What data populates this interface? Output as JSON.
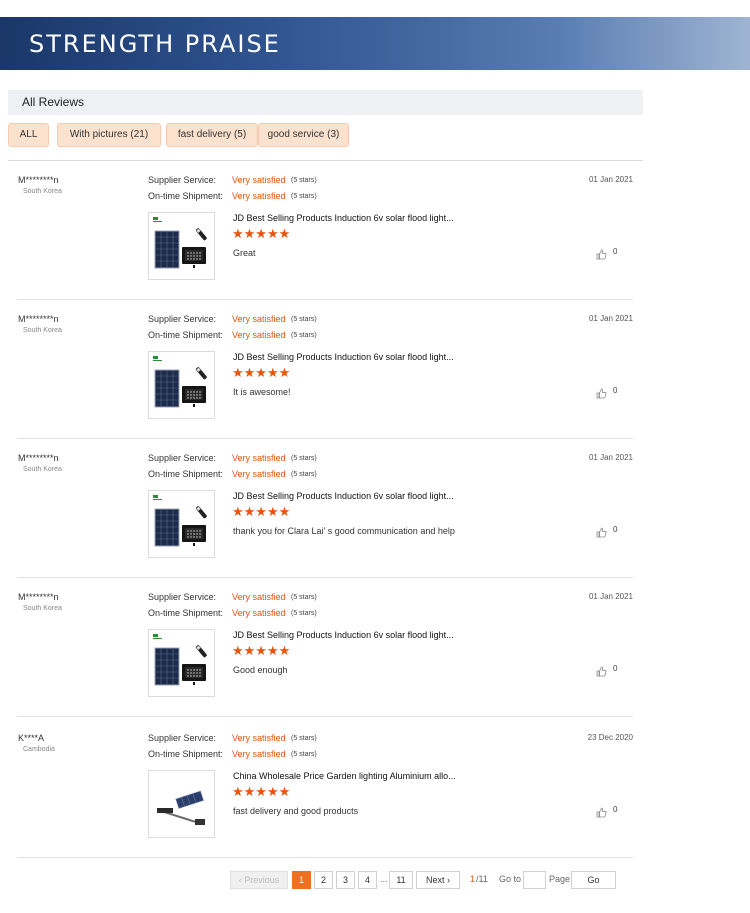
{
  "banner": {
    "title": "STRENGTH PRAISE"
  },
  "tabs": {
    "all_reviews": "All Reviews"
  },
  "filters": [
    "ALL",
    "With pictures (21)",
    "fast delivery (5)",
    "good service (3)"
  ],
  "labels": {
    "supplier_service": "Supplier Service:",
    "ontime_shipment": "On-time Shipment:",
    "very_satisfied": "Very satisfied",
    "five_stars": "(5 stars)",
    "star_glyphs": "★★★★★"
  },
  "reviews": [
    {
      "user": "M********n",
      "country": "South Korea",
      "date": "01 Jan 2021",
      "product": "JD Best Selling Products Induction 6v solar flood light...",
      "comment": "Great",
      "likes": "0",
      "thumb": "solar-panel-flood-light"
    },
    {
      "user": "M********n",
      "country": "South Korea",
      "date": "01 Jan 2021",
      "product": "JD Best Selling Products Induction 6v solar flood light...",
      "comment": "It is awesome!",
      "likes": "0",
      "thumb": "solar-panel-flood-light"
    },
    {
      "user": "M********n",
      "country": "South Korea",
      "date": "01 Jan 2021",
      "product": "JD Best Selling Products Induction 6v solar flood light...",
      "comment": "thank you for Clara Lai' s good communication and help",
      "likes": "0",
      "thumb": "solar-panel-flood-light"
    },
    {
      "user": "M********n",
      "country": "South Korea",
      "date": "01 Jan 2021",
      "product": "JD Best Selling Products Induction 6v solar flood light...",
      "comment": "Good enough",
      "likes": "0",
      "thumb": "solar-panel-flood-light"
    },
    {
      "user": "K****A",
      "country": "Cambodia",
      "date": "23 Dec 2020",
      "product": "China Wholesale Price Garden lighting Aluminium allo...",
      "comment": "fast delivery and good products",
      "likes": "0",
      "thumb": "solar-street-light"
    }
  ],
  "pagination": {
    "previous": "Previous",
    "pages": [
      "1",
      "2",
      "3",
      "4"
    ],
    "ellipsis": "...",
    "last": "11",
    "next": "Next",
    "current": "1",
    "total": "/11",
    "goto_label": "Go to",
    "page_label": "Page",
    "go_button": "Go",
    "goto_value": ""
  },
  "colors": {
    "accent": "#e8530e",
    "active_page": "#f2701d",
    "filter_bg": "#fbe2cf",
    "banner": "#2f538f"
  }
}
